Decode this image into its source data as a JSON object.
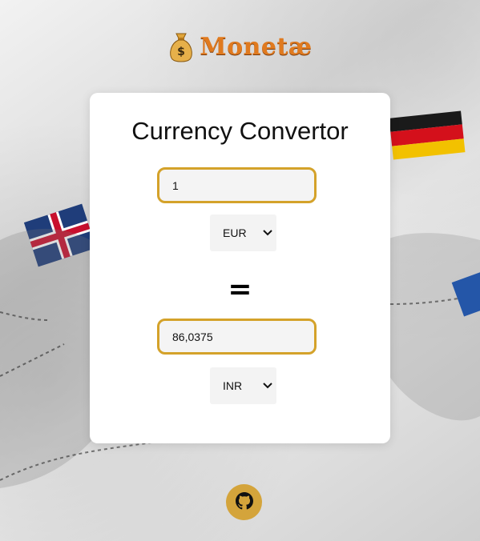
{
  "brand": {
    "name": "Monetæ",
    "icon": "money-bag-icon"
  },
  "converter": {
    "title": "Currency Convertor",
    "from_amount": "1",
    "from_currency": "EUR",
    "equals_symbol": "=",
    "to_amount": "86,0375",
    "to_currency": "INR"
  },
  "footer": {
    "github_icon": "github-icon"
  },
  "colors": {
    "accent_border": "#d4a22a",
    "brand_text": "#e07a1f",
    "github_button": "#d4a43b",
    "card_background": "#ffffff"
  }
}
